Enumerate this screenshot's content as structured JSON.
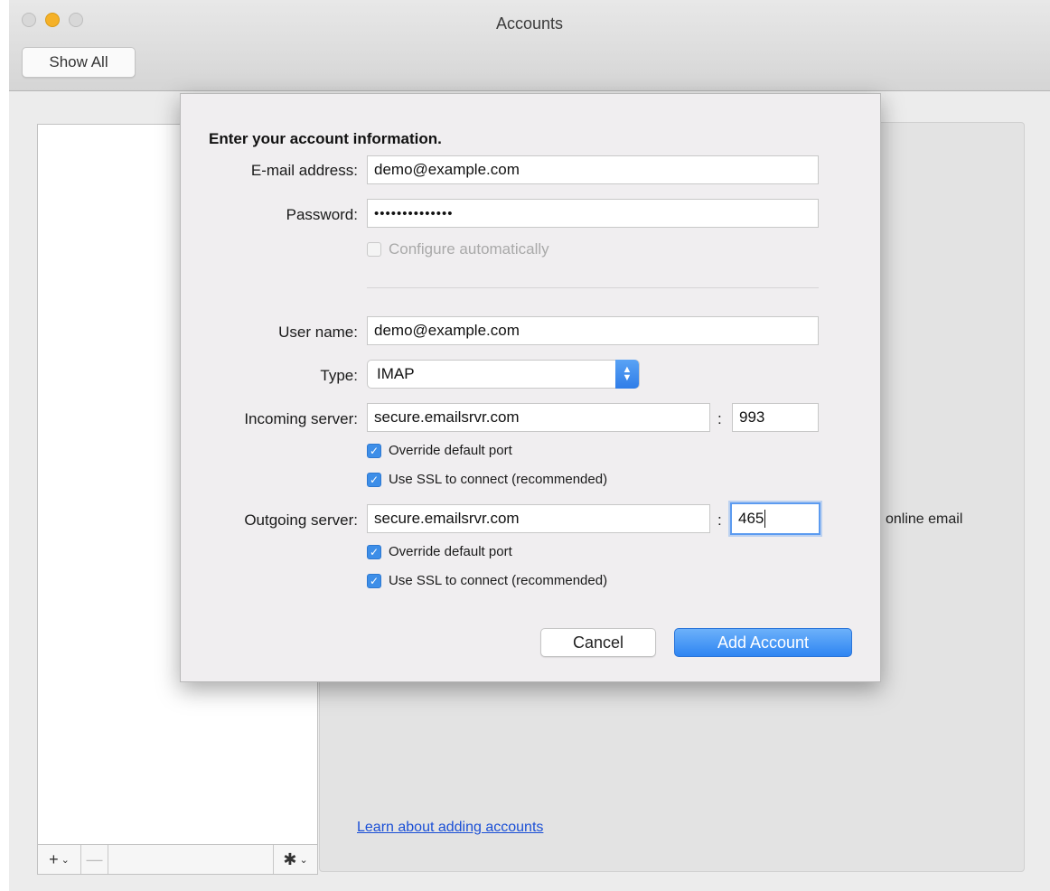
{
  "window": {
    "title": "Accounts",
    "show_all_label": "Show All"
  },
  "list_footer": {
    "add_symbol": "+",
    "remove_symbol": "—",
    "gear_symbol": "✱",
    "chevron": "⌄"
  },
  "right_panel": {
    "online_text": "online email",
    "learn_link": "Learn about adding accounts"
  },
  "sheet": {
    "heading": "Enter your account information.",
    "email_label": "E-mail address:",
    "email_value": "demo@example.com",
    "password_label": "Password:",
    "password_value": "••••••••••••••",
    "configure_label": "Configure automatically",
    "configure_checked": false,
    "username_label": "User name:",
    "username_value": "demo@example.com",
    "type_label": "Type:",
    "type_value": "IMAP",
    "incoming_label": "Incoming server:",
    "incoming_server": "secure.emailsrvr.com",
    "incoming_port": "993",
    "incoming_override_label": "Override default port",
    "incoming_ssl_label": "Use SSL to connect (recommended)",
    "outgoing_label": "Outgoing server:",
    "outgoing_server": "secure.emailsrvr.com",
    "outgoing_port": "465",
    "outgoing_override_label": "Override default port",
    "outgoing_ssl_label": "Use SSL to connect (recommended)",
    "colon": ":",
    "cancel_label": "Cancel",
    "add_account_label": "Add Account"
  },
  "colors": {
    "accent": "#3d8ee8",
    "link": "#1a4fd6"
  }
}
